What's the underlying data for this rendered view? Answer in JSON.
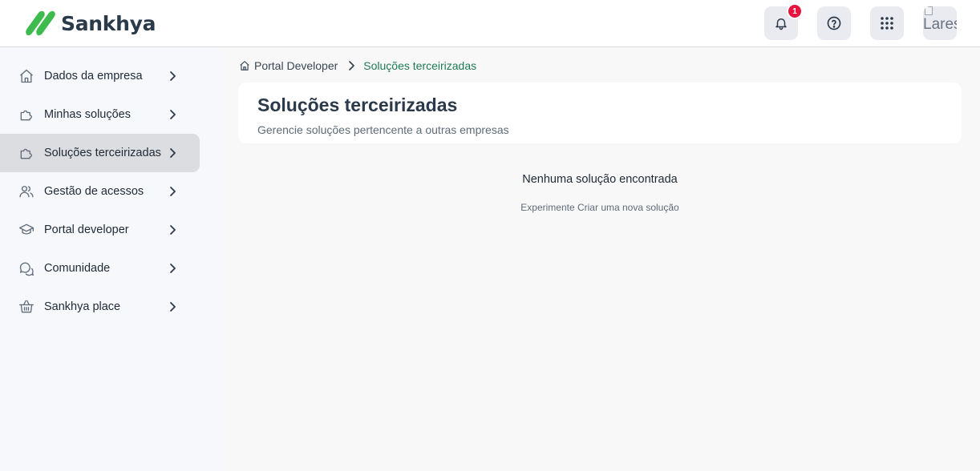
{
  "app": {
    "brand_name": "Sankhya",
    "brand_color": "#3dbb4e",
    "accent_color": "#1f7a55"
  },
  "topbar": {
    "notifications": {
      "icon": "bell-icon",
      "count": "1"
    },
    "help": {
      "icon": "help-circle-icon"
    },
    "apps": {
      "icon": "grid-dots-icon"
    },
    "avatar": {
      "alt_text": "Lares"
    }
  },
  "sidebar": {
    "items": [
      {
        "label": "Dados da empresa",
        "icon": "home-icon",
        "active": false
      },
      {
        "label": "Minhas soluções",
        "icon": "puzzle-icon",
        "active": false
      },
      {
        "label": "Soluções terceirizadas",
        "icon": "puzzle-icon",
        "active": true
      },
      {
        "label": "Gestão de acessos",
        "icon": "users-icon",
        "active": false
      },
      {
        "label": "Portal developer",
        "icon": "graduation-cap-icon",
        "active": false
      },
      {
        "label": "Comunidade",
        "icon": "chat-bubbles-icon",
        "active": false
      },
      {
        "label": "Sankhya place",
        "icon": "basket-icon",
        "active": false
      }
    ]
  },
  "breadcrumb": {
    "home_label": "Portal Developer",
    "current": "Soluções terceirizadas"
  },
  "header": {
    "title": "Soluções terceirizadas",
    "subtitle": "Gerencie soluções pertencente a outras empresas"
  },
  "empty_state": {
    "title": "Nenhuma solução encontrada",
    "hint": "Experimente Criar uma nova solução"
  }
}
